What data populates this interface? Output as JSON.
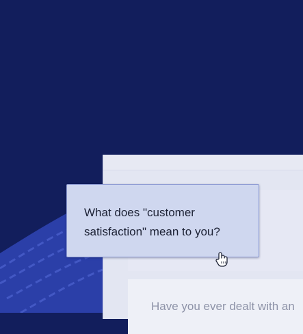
{
  "tooltip": {
    "line1": "What does \"customer",
    "line2": "satisfaction\" mean to you?"
  },
  "panel": {
    "card_text": "Have you ever dealt with an"
  },
  "icons": {
    "cursor": "hand-pointer-icon"
  },
  "colors": {
    "background": "#121e5c",
    "accent_wave": "#2b3fa8",
    "tooltip_bg": "#cfd7ef",
    "tooltip_border": "#8e9bd3"
  }
}
